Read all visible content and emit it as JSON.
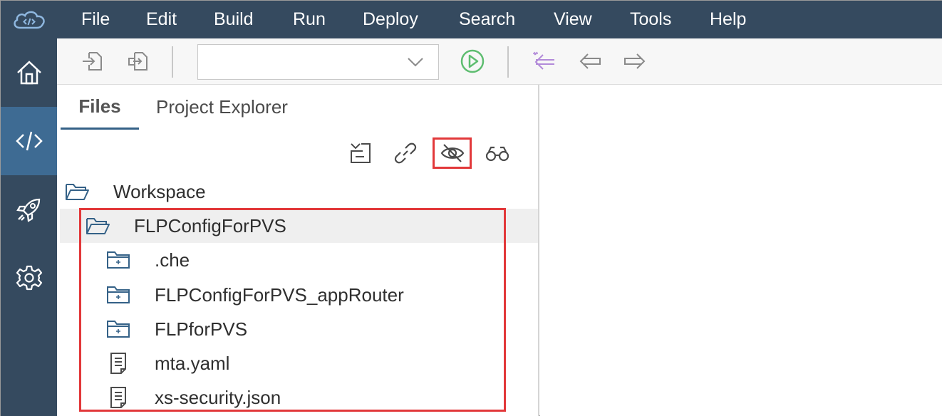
{
  "menubar": {
    "logo_icon": "cloud-code-icon",
    "items": [
      "File",
      "Edit",
      "Build",
      "Run",
      "Deploy",
      "Search",
      "View",
      "Tools",
      "Help"
    ]
  },
  "leftbar": {
    "items": [
      {
        "icon": "home-icon",
        "active": false
      },
      {
        "icon": "code-icon",
        "active": true
      },
      {
        "icon": "rocket-icon",
        "active": false
      },
      {
        "icon": "gear-icon",
        "active": false
      }
    ]
  },
  "toolbar": {
    "run_config_value": "",
    "buttons": [
      "import-icon",
      "export-icon",
      "run-icon",
      "back-starred-icon",
      "back-icon",
      "forward-icon"
    ]
  },
  "files_panel": {
    "tabs": [
      "Files",
      "Project Explorer"
    ],
    "active_tab": "Files",
    "tools": [
      "collapse-all-icon",
      "link-editor-icon",
      "hidden-files-icon",
      "find-icon"
    ],
    "highlighted_tool": "hidden-files-icon"
  },
  "tree": {
    "workspace": "Workspace",
    "project": "FLPConfigForPVS",
    "children": [
      {
        "label": ".che",
        "type": "folder"
      },
      {
        "label": "FLPConfigForPVS_appRouter",
        "type": "folder"
      },
      {
        "label": "FLPforPVS",
        "type": "folder"
      },
      {
        "label": "mta.yaml",
        "type": "file"
      },
      {
        "label": "xs-security.json",
        "type": "file"
      }
    ]
  },
  "colors": {
    "shell": "#354a5f",
    "active_nav": "#3e6b93",
    "accent": "#346187",
    "highlight": "#e2383a",
    "run_green": "#5ebd70",
    "nav_purple": "#b28ad9"
  }
}
